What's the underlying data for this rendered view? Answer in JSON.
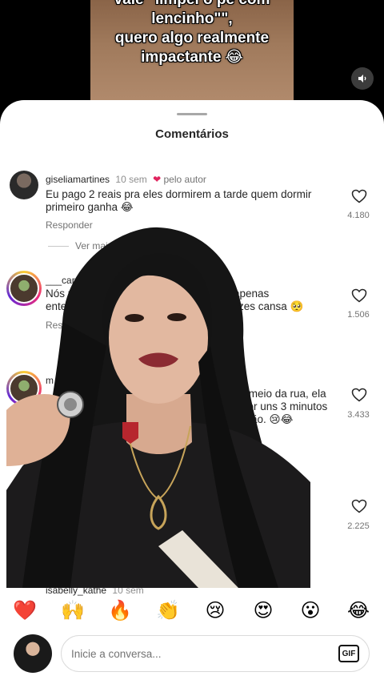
{
  "video": {
    "caption_line1": "vale \"limpei o pé com",
    "caption_line2": "lencinho\"\",",
    "caption_line3": "quero algo realmente",
    "caption_line4": "impactante 😂",
    "mute_icon": "speaker-icon"
  },
  "sheet": {
    "title": "Comentários"
  },
  "comments": [
    {
      "user": "giseliamartines",
      "time": "10 sem",
      "by_author": "pelo autor",
      "text": "Eu pago 2 reais pra eles dormirem a tarde quem dormir primeiro ganha 😂",
      "reply": "Responder",
      "likes": "4.180",
      "view_more": "Ver mai"
    },
    {
      "user": "___carol",
      "by_author": "tor",
      "text_a": "Nós m",
      "text_b": "outras, apenas",
      "text_c": "enten",
      "text_d": "de às vezes cansa 🥺",
      "reply": "Resp",
      "likes": "1.506"
    },
    {
      "user": "m",
      "text_a": "no meio da rua, ela",
      "text_b": "por uns 3 minutos",
      "text_c": "ão. 😢😂",
      "likes": "3.433"
    },
    {
      "likes": "2.225"
    },
    {
      "user": "isabelly_kathe",
      "time": "10 sem"
    }
  ],
  "emojis": [
    "❤️",
    "🙌",
    "🔥",
    "👏",
    "😢",
    "😍",
    "😮",
    "😂"
  ],
  "input": {
    "placeholder": "Inicie a conversa...",
    "gif_label": "GIF"
  }
}
